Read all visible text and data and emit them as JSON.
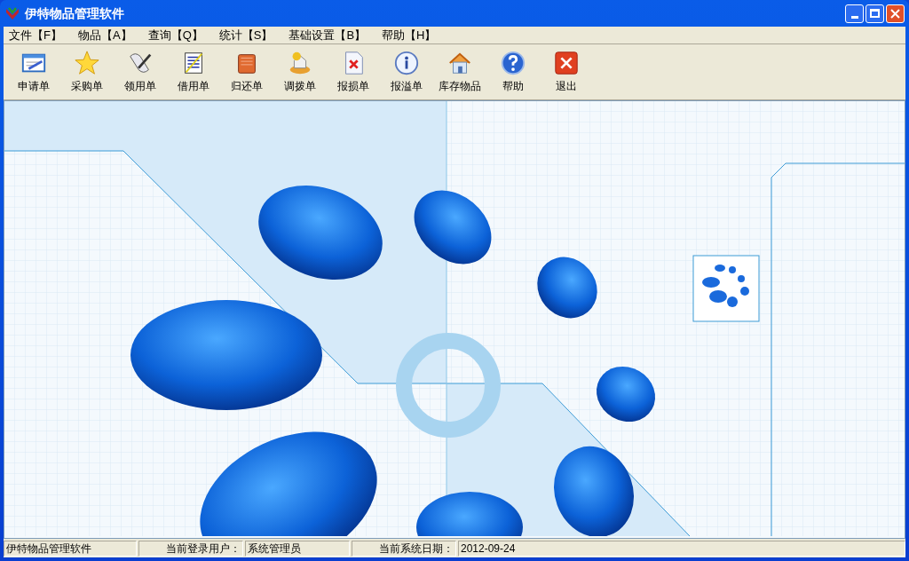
{
  "window": {
    "title": "伊特物品管理软件"
  },
  "menu": [
    "文件【F】",
    "物品【A】",
    "查询【Q】",
    "统计【S】",
    "基础设置【B】",
    "帮助【H】"
  ],
  "toolbar": [
    {
      "label": "申请单"
    },
    {
      "label": "采购单"
    },
    {
      "label": "领用单"
    },
    {
      "label": "借用单"
    },
    {
      "label": "归还单"
    },
    {
      "label": "调拨单"
    },
    {
      "label": "报损单"
    },
    {
      "label": "报溢单"
    },
    {
      "label": "库存物品"
    },
    {
      "label": "帮助"
    },
    {
      "label": "退出"
    }
  ],
  "status_bar": {
    "app": "伊特物品管理软件",
    "user_label": "当前登录用户：",
    "user": "系统管理员",
    "date_label": "当前系统日期：",
    "date": "2012-09-24"
  }
}
